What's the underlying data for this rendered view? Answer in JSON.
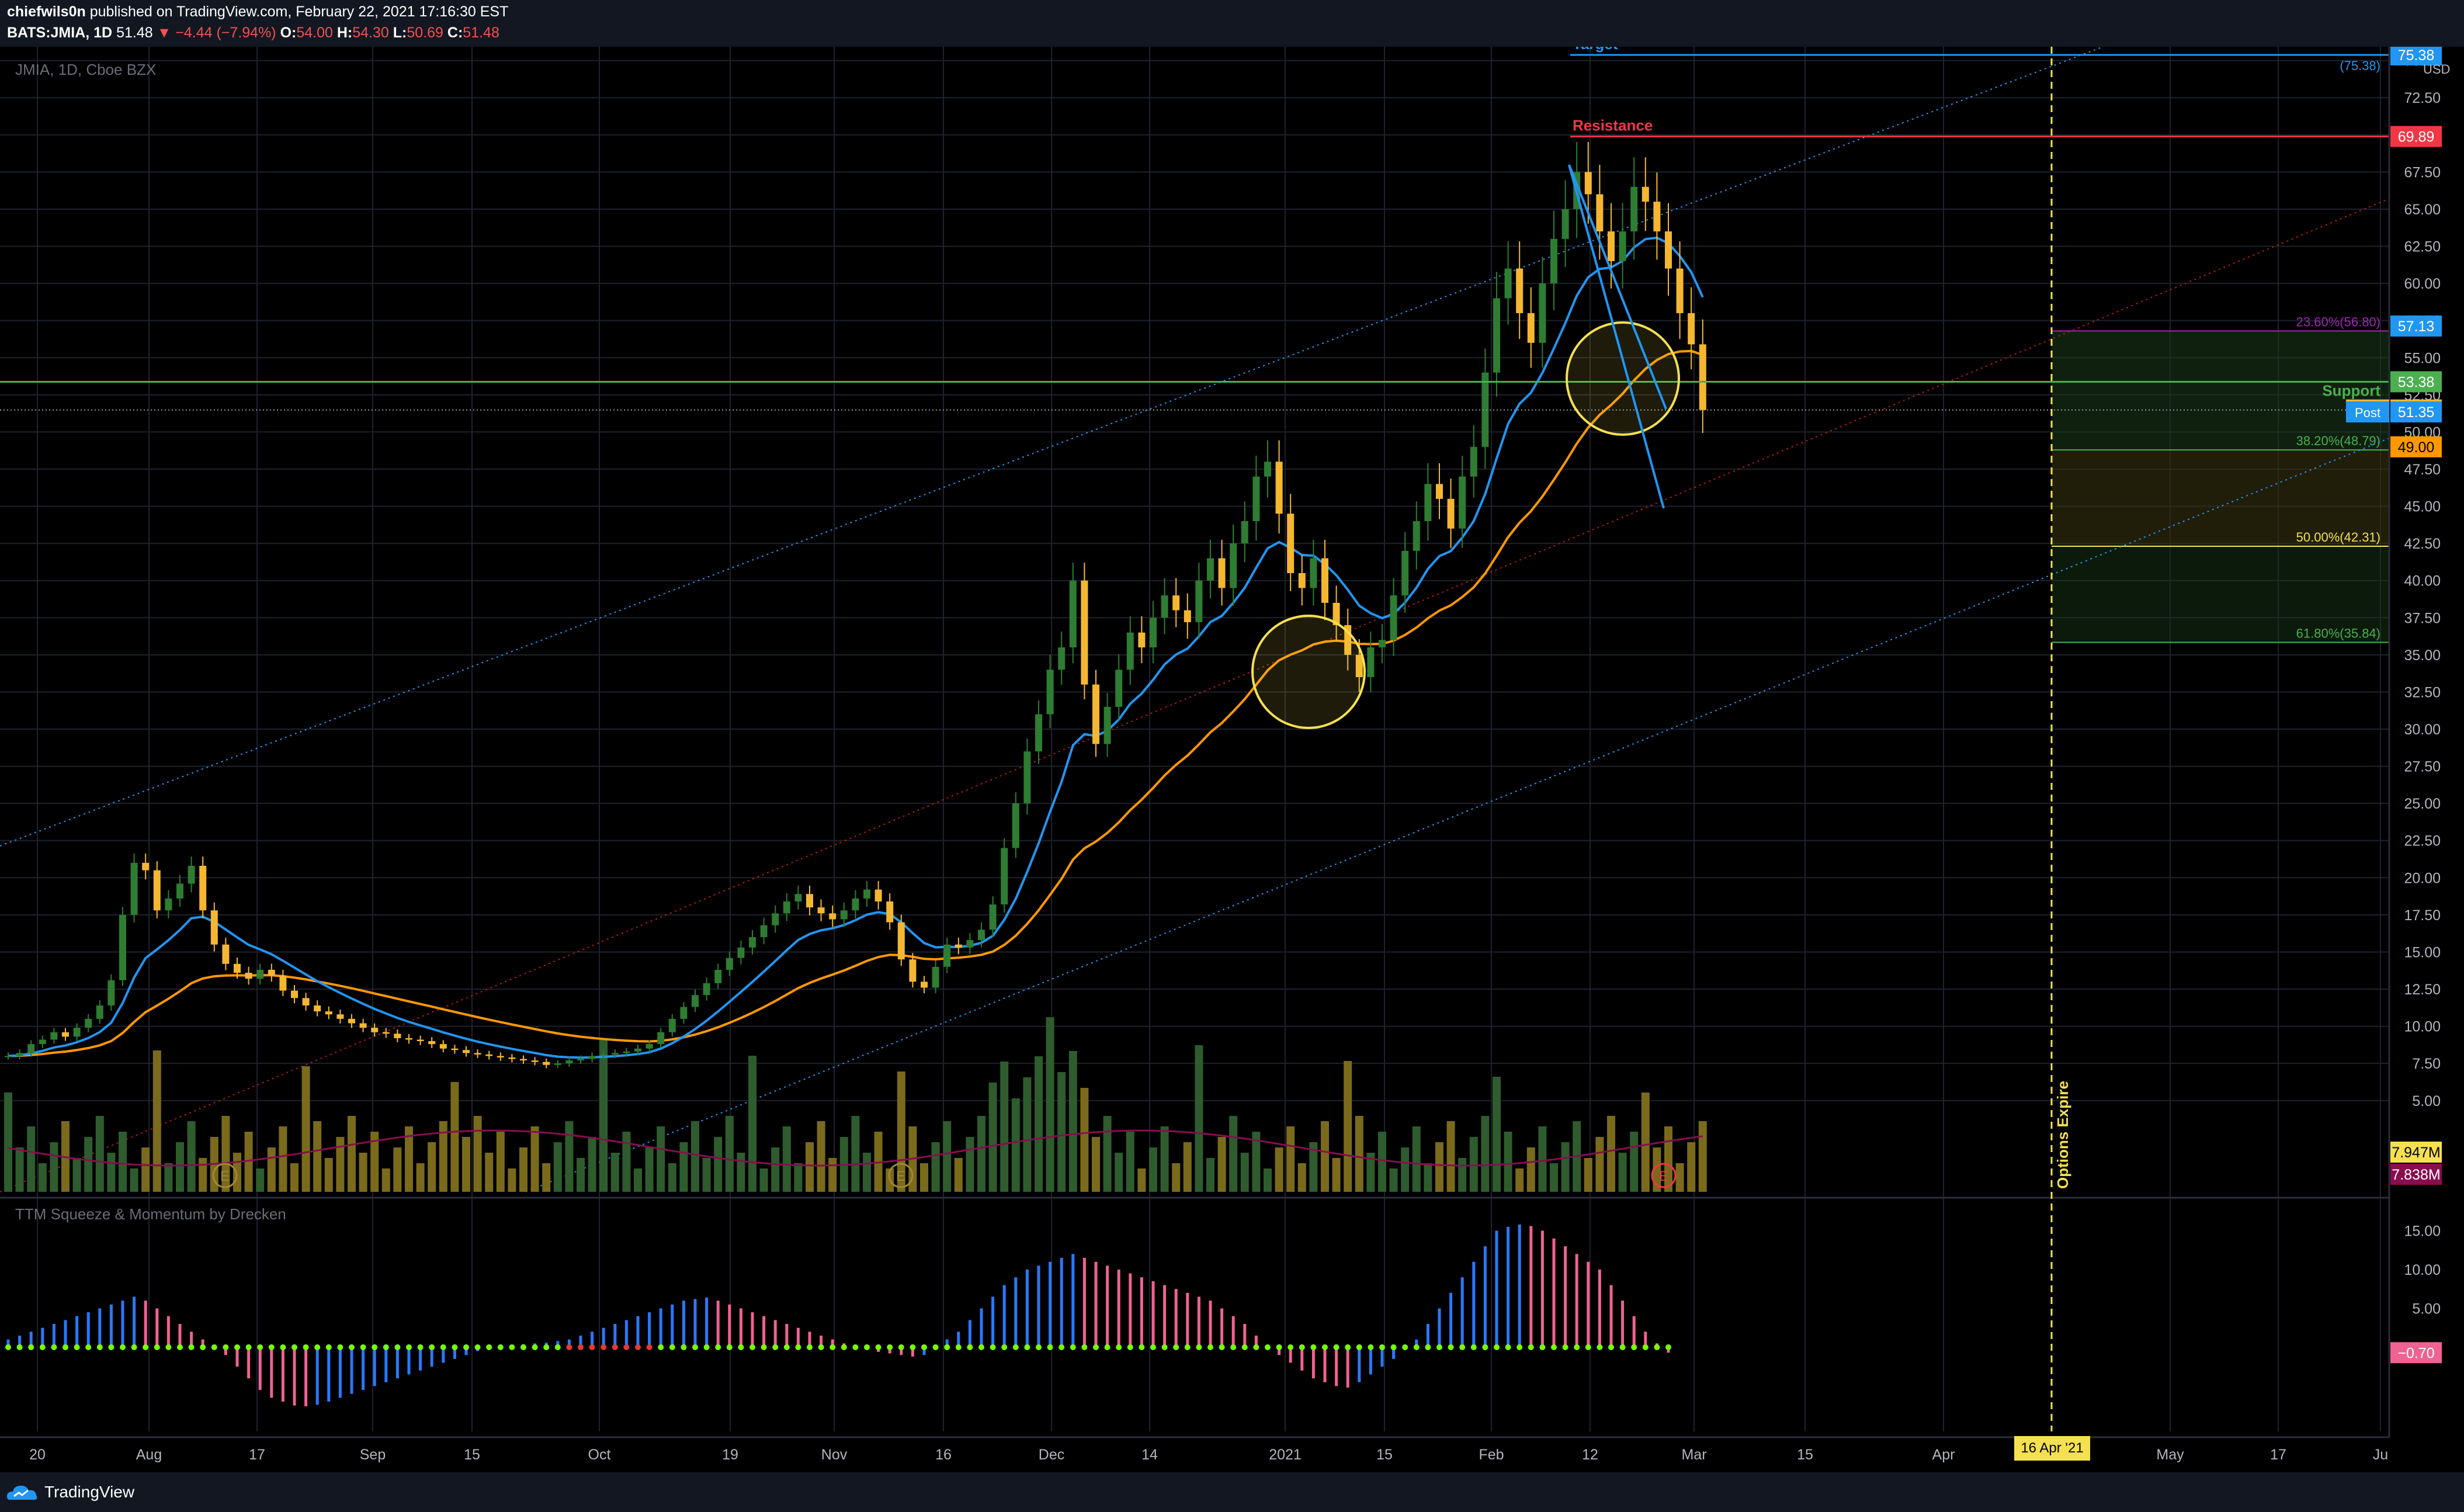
{
  "header": {
    "author": "chiefwils0n",
    "published": "published on TradingView.com, February 22, 2021 17:16:30 EST",
    "symbol": "BATS:JMIA, 1D",
    "last": "51.48",
    "change": "−4.44 (−7.94%)",
    "o_label": "O:",
    "o": "54.00",
    "h_label": "H:",
    "h": "54.30",
    "l_label": "L:",
    "l": "50.69",
    "c_label": "C:",
    "c": "51.48"
  },
  "chart_data": {
    "type": "candlestick",
    "symbol_label": "JMIA, 1D, Cboe BZX",
    "currency": "USD",
    "ylim": [
      0,
      77.5
    ],
    "y_ticks": [
      5.0,
      7.5,
      10.0,
      12.5,
      15.0,
      17.5,
      20.0,
      22.5,
      25.0,
      27.5,
      30.0,
      32.5,
      35.0,
      37.5,
      40.0,
      42.5,
      45.0,
      47.5,
      50.0,
      52.5,
      55.0,
      57.5,
      60.0,
      62.5,
      65.0,
      67.5,
      70.0,
      72.5,
      75.0,
      77.5
    ],
    "y_tick_labels": [
      "5.00",
      "7.50",
      "10.00",
      "12.50",
      "15.00",
      "17.50",
      "20.00",
      "22.50",
      "25.00",
      "27.50",
      "30.00",
      "32.50",
      "35.00",
      "37.50",
      "40.00",
      "42.50",
      "45.00",
      "47.50",
      "50.00",
      "52.50",
      "55.00",
      "57.50",
      "60.00",
      "62.50",
      "65.00",
      "67.50",
      "70.00",
      "72.50",
      "75.00",
      "77.50"
    ],
    "x_tick_labels": [
      "20",
      "Aug",
      "17",
      "Sep",
      "15",
      "Oct",
      "19",
      "Nov",
      "16",
      "Dec",
      "14",
      "2021",
      "15",
      "Feb",
      "12",
      "Mar",
      "15",
      "Apr",
      "May",
      "17",
      "Ju"
    ],
    "price_closes": [
      8,
      8.2,
      8.8,
      9.1,
      9.6,
      9.3,
      9.9,
      10.5,
      11.4,
      13.1,
      17.5,
      21,
      20.5,
      17.8,
      18.6,
      19.6,
      20.8,
      17.8,
      15.5,
      14.2,
      13.6,
      13.2,
      13.8,
      13.4,
      12.4,
      11.9,
      11.4,
      11.0,
      10.8,
      10.5,
      10.2,
      9.9,
      9.6,
      9.5,
      9.2,
      9.1,
      9.0,
      8.8,
      8.5,
      8.4,
      8.2,
      8.1,
      8.0,
      7.9,
      7.8,
      7.7,
      7.6,
      7.4,
      7.5,
      7.7,
      7.8,
      8.0,
      8.1,
      8.2,
      8.3,
      8.5,
      8.8,
      9.6,
      10.5,
      11.3,
      12.1,
      12.9,
      13.8,
      14.6,
      15.3,
      16.0,
      16.8,
      17.6,
      18.4,
      18.9,
      18.0,
      17.6,
      17.2,
      17.8,
      18.6,
      19.2,
      18.4,
      17.0,
      14.5,
      13.0,
      12.6,
      14.0,
      15.5,
      15.3,
      15.8,
      16.5,
      18.2,
      22.0,
      25.0,
      28.5,
      31.0,
      34.0,
      35.5,
      40.0,
      33.0,
      29.0,
      31.5,
      34.0,
      36.5,
      35.5,
      37.5,
      39.0,
      38.0,
      37.2,
      40.0,
      41.5,
      39.5,
      42.5,
      44.0,
      47.0,
      48.0,
      44.5,
      40.5,
      39.5,
      41.5,
      38.5,
      37.0,
      35.0,
      33.5,
      35.5,
      36.0,
      39.0,
      42.0,
      44.0,
      46.5,
      45.5,
      43.5,
      47.0,
      49.0,
      54.0,
      59.0,
      61.0,
      58.0,
      56.0,
      60.0,
      63.0,
      65.0,
      67.5,
      66.0,
      63.5,
      61.5,
      63.5,
      66.5,
      65.5,
      63.5,
      61.0,
      58.0,
      55.9,
      51.48
    ],
    "ema_fast_label": "blue moving average",
    "lines": {
      "target": {
        "label": "Target",
        "value": 75.38,
        "note": "(75.38)",
        "color": "#2196f3"
      },
      "resistance": {
        "label": "Resistance",
        "value": 69.89,
        "color": "#f23645"
      },
      "support": {
        "label": "Support",
        "value": 53.38,
        "color": "#4caf50"
      },
      "options_expire": {
        "label": "Options Expire",
        "date_label": "16 Apr '21",
        "color": "#f5e050"
      }
    },
    "fib_levels": [
      {
        "label": "23.60%(56.80)",
        "value": 56.8,
        "color": "#9c27b0"
      },
      {
        "label": "38.20%(48.79)",
        "value": 48.79,
        "color": "#4caf50"
      },
      {
        "label": "50.00%(42.31)",
        "value": 42.31,
        "color": "#f5e050"
      },
      {
        "label": "61.80%(35.84)",
        "value": 35.84,
        "color": "#4caf50"
      }
    ],
    "price_badges": [
      {
        "text": "75.38",
        "value": 75.38,
        "bg": "#2196f3",
        "fg": "#ffffff"
      },
      {
        "text": "69.89",
        "value": 69.89,
        "bg": "#f23645",
        "fg": "#ffffff"
      },
      {
        "text": "57.13",
        "value": 57.13,
        "bg": "#2196f3",
        "fg": "#ffffff"
      },
      {
        "text": "53.38",
        "value": 53.38,
        "bg": "#4caf50",
        "fg": "#ffffff"
      },
      {
        "text": "51.48",
        "value": 51.48,
        "bg": "#f5b731",
        "fg": "#000000",
        "tag": "JMIA"
      },
      {
        "text": "51.35",
        "value": 51.35,
        "bg": "#2196f3",
        "fg": "#ffffff",
        "tag": "Post"
      },
      {
        "text": "49.00",
        "value": 49.0,
        "bg": "#ff9800",
        "fg": "#000000"
      }
    ],
    "volume_badges": [
      {
        "text": "7.947M",
        "bg": "#f5e050",
        "fg": "#000000"
      },
      {
        "text": "7.838M",
        "bg": "#880e4f",
        "fg": "#ffffff"
      }
    ],
    "earnings_markers": [
      "E",
      "E",
      "E"
    ],
    "indicator": {
      "title": "TTM Squeeze & Momentum by Drecken",
      "ylim": [
        -10,
        17.5
      ],
      "y_ticks": [
        15,
        10,
        5,
        0
      ],
      "y_tick_labels": [
        "15.00",
        "10.00",
        "5.00",
        "0.00"
      ],
      "last_value_label": "−0.70",
      "momentum": [
        1,
        1.5,
        2,
        2.5,
        3,
        3.5,
        4,
        4.5,
        5,
        5.5,
        6,
        6.5,
        6,
        5,
        4,
        3,
        2,
        1,
        0,
        -1,
        -2.5,
        -4,
        -5.5,
        -6.5,
        -7,
        -7.5,
        -7.6,
        -7.4,
        -7,
        -6.5,
        -6,
        -5.5,
        -5,
        -4.5,
        -4,
        -3.5,
        -3,
        -2.5,
        -2,
        -1.5,
        -1,
        -0.5,
        0,
        0.2,
        0.3,
        0.4,
        0.5,
        0.6,
        0.8,
        1,
        1.5,
        2,
        2.5,
        3,
        3.5,
        4,
        4.5,
        5,
        5.5,
        6,
        6.2,
        6.4,
        6,
        5.5,
        5,
        4.5,
        4,
        3.5,
        3,
        2.5,
        2,
        1.5,
        1,
        0.5,
        0,
        -0.3,
        -0.6,
        -0.8,
        -1,
        -1.2,
        -1,
        0,
        1,
        2,
        3.5,
        5,
        6.5,
        8,
        9,
        10,
        10.5,
        11,
        11.5,
        12,
        11.5,
        11,
        10.5,
        10,
        9.5,
        9,
        8.5,
        8,
        7.5,
        7,
        6.5,
        6,
        5,
        4,
        3,
        1.5,
        0,
        -1,
        -2,
        -3,
        -4,
        -4.5,
        -5,
        -5.2,
        -4.5,
        -3.5,
        -2.5,
        -1.5,
        0,
        1,
        3,
        5,
        7,
        9,
        11,
        13,
        15,
        15.5,
        15.8,
        15.6,
        15,
        14,
        13,
        12,
        11,
        10,
        8,
        6,
        4,
        2,
        0.5,
        -0.7
      ]
    }
  },
  "footer": {
    "brand": "TradingView"
  }
}
